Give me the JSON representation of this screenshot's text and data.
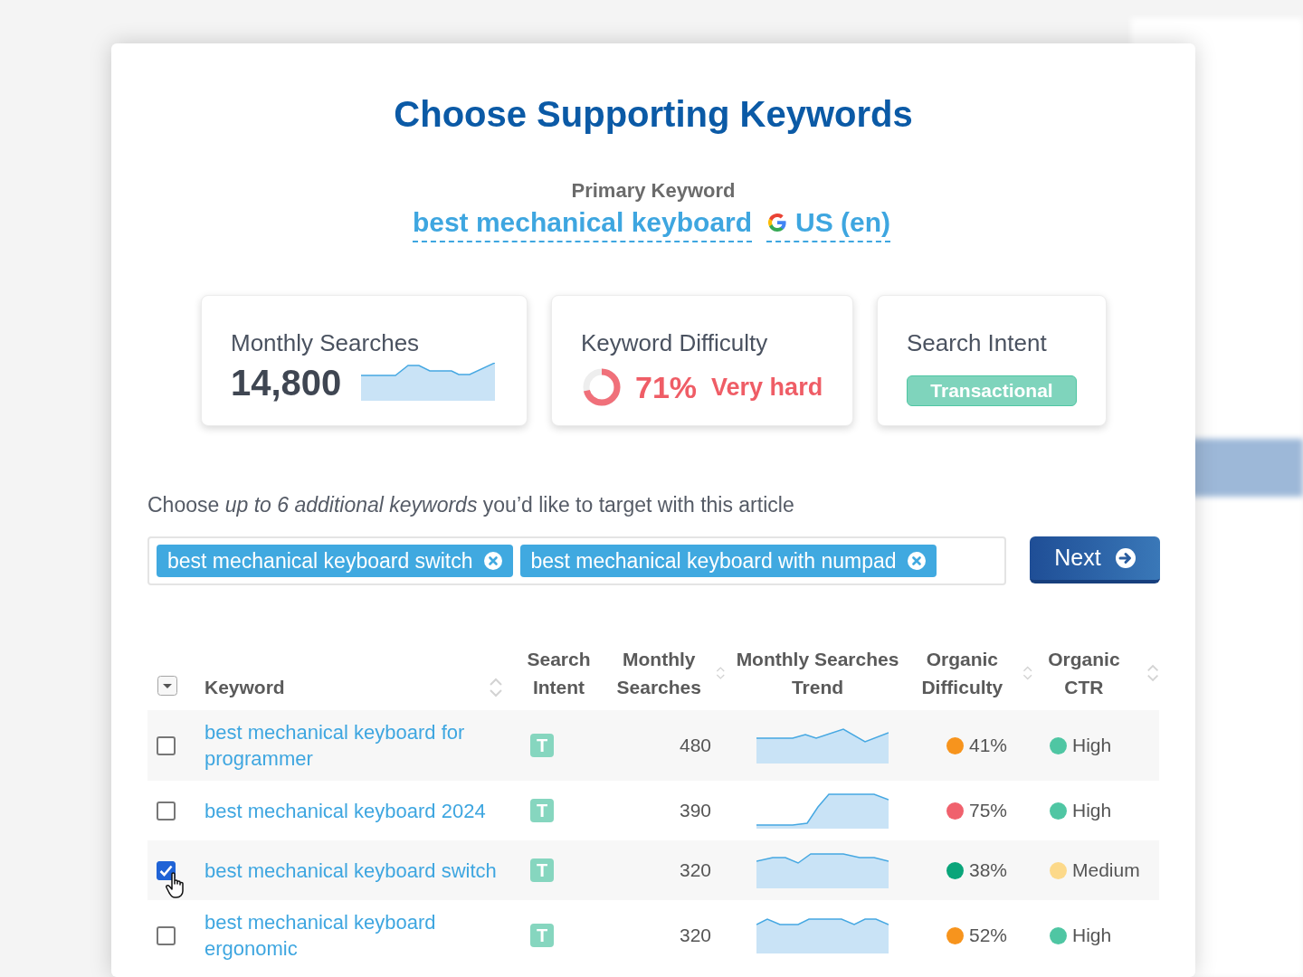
{
  "title": "Choose Supporting Keywords",
  "primary_keyword": {
    "label": "Primary Keyword",
    "keyword": "best mechanical keyboard",
    "location": "US (en)"
  },
  "stats": {
    "monthly_searches": {
      "label": "Monthly Searches",
      "value": "14,800"
    },
    "keyword_difficulty": {
      "label": "Keyword Difficulty",
      "value": "71%",
      "level": 0.71,
      "rating": "Very hard"
    },
    "search_intent": {
      "label": "Search Intent",
      "value": "Transactional"
    }
  },
  "instruction": "Choose *up to 6 additional keywords* you’d like to target with this article",
  "chips": [
    {
      "label": "best mechanical keyboard switch"
    },
    {
      "label": "best mechanical keyboard with numpad"
    }
  ],
  "next_button": {
    "label": "Next"
  },
  "table": {
    "columns": [
      "Keyword",
      "Search Intent",
      "Monthly Searches",
      "Monthly Searches Trend",
      "Organic Difficulty",
      "Organic CTR"
    ],
    "rows": [
      {
        "checked": false,
        "keyword": "best mechanical keyboard for programmer",
        "intent": "T",
        "searches": "480",
        "difficulty": {
          "value": "41%",
          "color": "#f7941d"
        },
        "ctr": {
          "value": "High",
          "color": "#4fc6a3"
        }
      },
      {
        "checked": false,
        "keyword": "best mechanical keyboard 2024",
        "intent": "T",
        "searches": "390",
        "difficulty": {
          "value": "75%",
          "color": "#f0616d"
        },
        "ctr": {
          "value": "High",
          "color": "#4fc6a3"
        }
      },
      {
        "checked": true,
        "keyword": "best mechanical keyboard switch",
        "intent": "T",
        "searches": "320",
        "difficulty": {
          "value": "38%",
          "color": "#0aa57a"
        },
        "ctr": {
          "value": "Medium",
          "color": "#fcd98a"
        }
      },
      {
        "checked": false,
        "keyword": "best mechanical keyboard ergonomic",
        "intent": "T",
        "searches": "320",
        "difficulty": {
          "value": "52%",
          "color": "#f7941d"
        },
        "ctr": {
          "value": "High",
          "color": "#4fc6a3"
        }
      }
    ]
  }
}
